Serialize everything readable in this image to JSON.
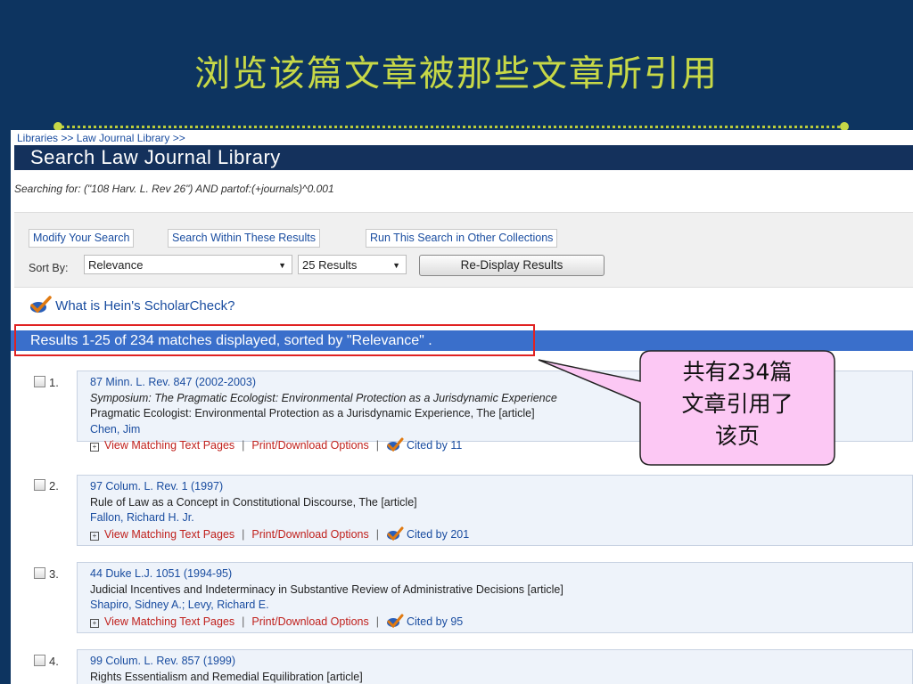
{
  "slide": {
    "title": "浏览该篇文章被那些文章所引用",
    "colors": {
      "background": "#0d3460",
      "title": "#c7d847"
    }
  },
  "breadcrumb": "Libraries >> Law Journal Library >>",
  "library_title": "Search Law Journal Library",
  "searching_for": "Searching for: (\"108 Harv. L. Rev 26\") AND partof:(+journals)^0.001",
  "actions": {
    "modify": "Modify Your Search",
    "within": "Search Within These Results",
    "other": "Run This Search in Other Collections"
  },
  "sort": {
    "label": "Sort By:",
    "selected": "Relevance",
    "per_page": "25 Results",
    "redisplay": "Re-Display Results"
  },
  "scholarcheck": "What is Hein's ScholarCheck?",
  "results_summary": "Results 1-25 of 234 matches displayed, sorted by \"Relevance\" .",
  "callout": {
    "line1": "共有234篇",
    "line2": "文章引用了",
    "line3": "该页"
  },
  "link_labels": {
    "view": "View Matching Text Pages",
    "print": "Print/Download Options",
    "sep": "|"
  },
  "results": [
    {
      "num": "1.",
      "citation": "87 Minn. L. Rev. 847 (2002-2003)",
      "subtitle": "Symposium: The Pragmatic Ecologist: Environmental Protection as a Jurisdynamic Experience",
      "title": "Pragmatic Ecologist: Environmental Protection as a Jurisdynamic Experience, The [article]",
      "author": "Chen, Jim",
      "cited": "Cited by 11"
    },
    {
      "num": "2.",
      "citation": "97 Colum. L. Rev. 1 (1997)",
      "title": "Rule of Law as a Concept in Constitutional Discourse, The [article]",
      "author": "Fallon, Richard H. Jr.",
      "cited": "Cited by 201"
    },
    {
      "num": "3.",
      "citation": "44 Duke L.J. 1051 (1994-95)",
      "title": "Judicial Incentives and Indeterminacy in Substantive Review of Administrative Decisions [article]",
      "author": "Shapiro, Sidney A.; Levy, Richard E.",
      "cited": "Cited by 95"
    },
    {
      "num": "4.",
      "citation": "99 Colum. L. Rev. 857 (1999)",
      "title": "Rights Essentialism and Remedial Equilibration [article]"
    }
  ]
}
